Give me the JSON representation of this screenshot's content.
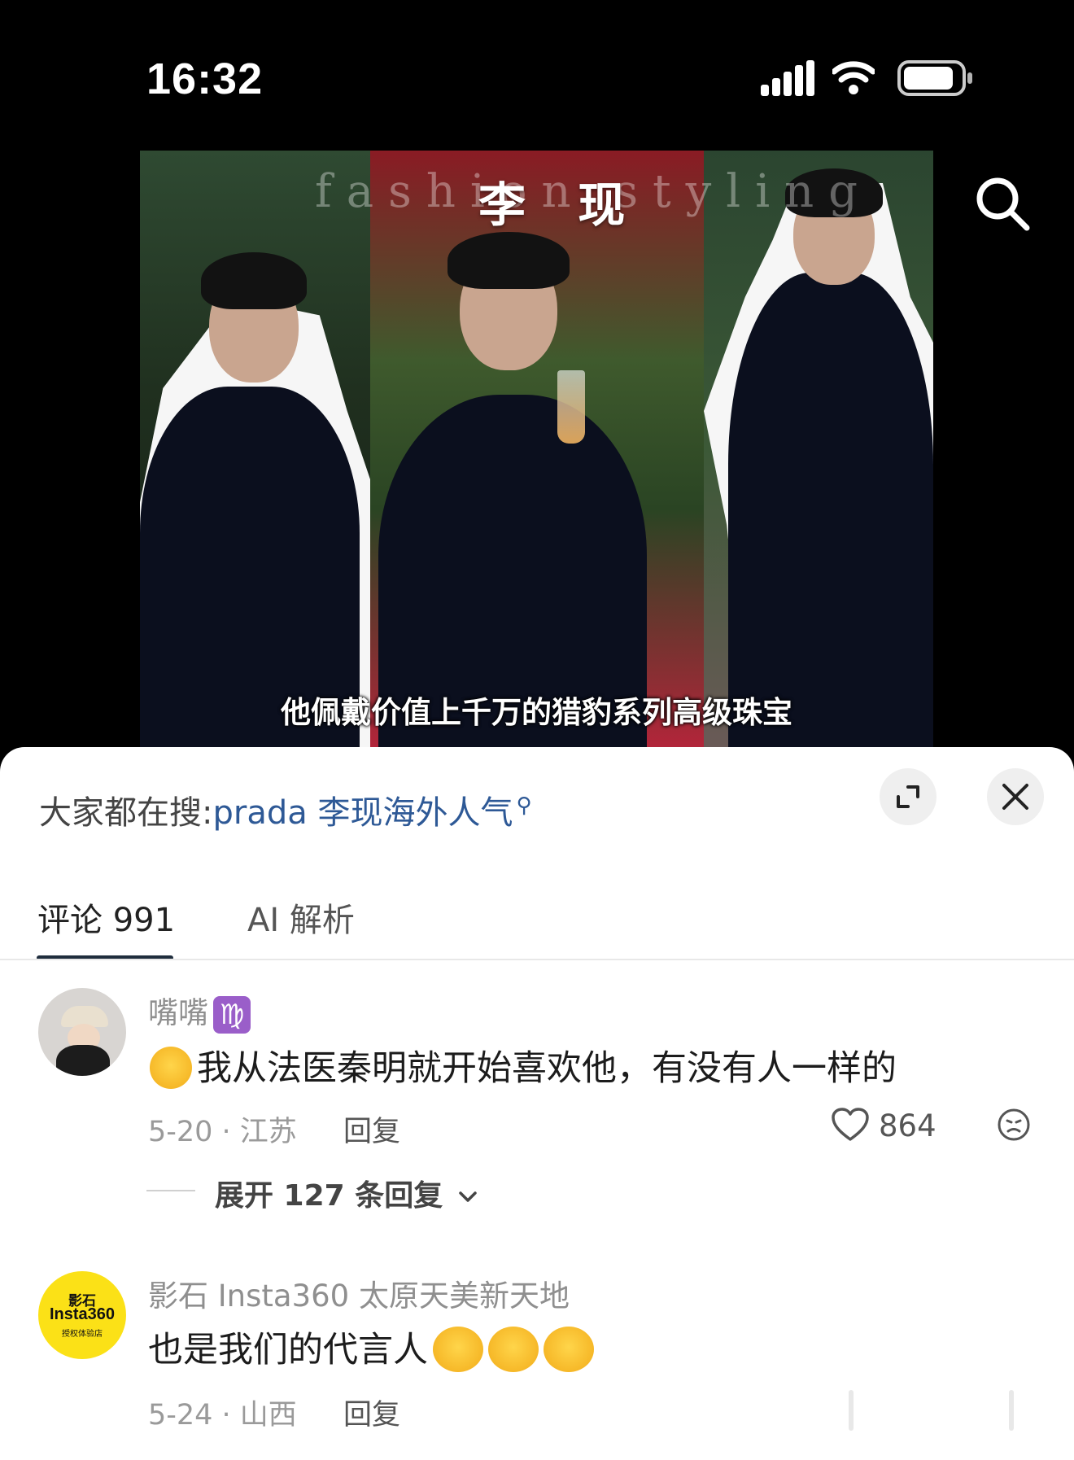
{
  "status_bar": {
    "time": "16:32",
    "signal_icon": "signal-icon",
    "wifi_icon": "wifi-icon",
    "battery_icon": "battery-icon"
  },
  "video": {
    "watermark": "fashion styling",
    "title": "李 现",
    "caption": "他佩戴价值上千万的猎豹系列高级珠宝",
    "search_icon": "search-icon"
  },
  "trending": {
    "label": "大家都在搜:",
    "query": "prada 李现海外人气",
    "search_icon": "search-icon"
  },
  "controls": {
    "expand_icon": "expand-icon",
    "close_icon": "close-icon"
  },
  "tabs": [
    {
      "label": "评论 991",
      "active": true
    },
    {
      "label": "AI 解析",
      "active": false
    }
  ],
  "comments": [
    {
      "username": "嘴嘴",
      "badge": "♍",
      "emoji": "crying-laughing-emoji",
      "text": "我从法医秦明就开始喜欢他，有没有人一样的",
      "date_location": "5-20 · 江苏",
      "reply_label": "回复",
      "likes": "864",
      "expand_label": "展开 127 条回复"
    },
    {
      "username": "影石 Insta360 太原天美新天地",
      "avatar_text": [
        "影石",
        "Insta360",
        "授权体验店"
      ],
      "text": "也是我们的代言人",
      "emojis": [
        "kiss-emoji",
        "kiss-emoji",
        "kiss-emoji"
      ],
      "date_location": "5-24 · 山西",
      "reply_label": "回复"
    }
  ],
  "colors": {
    "link": "#2e5996",
    "background_top": "#000000",
    "sheet": "#ffffff",
    "avatar_yellow": "#fbe117"
  }
}
